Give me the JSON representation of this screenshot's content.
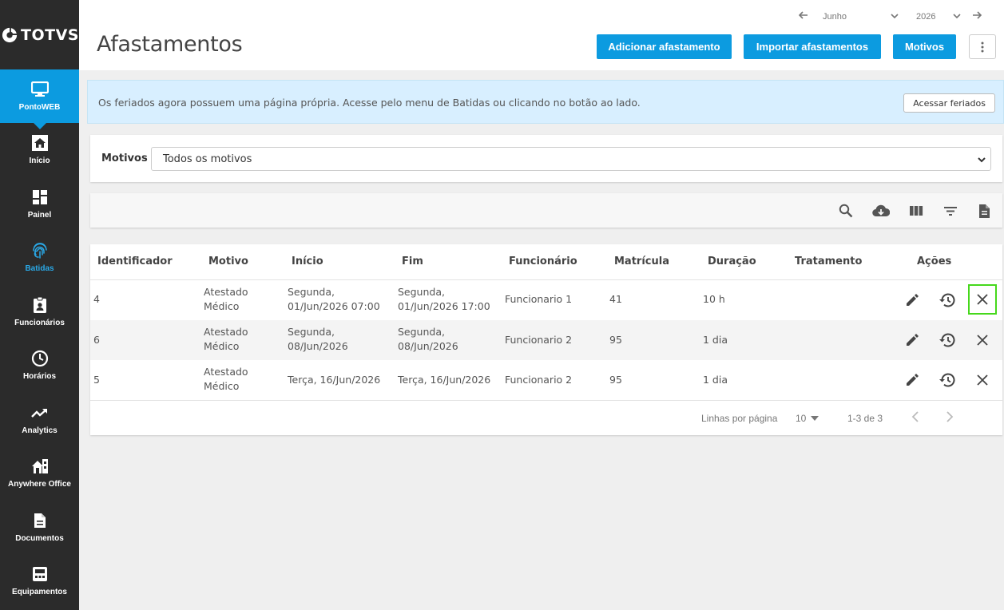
{
  "app": {
    "logo_text": "TOTVS"
  },
  "sidebar": {
    "items": [
      {
        "label": "PontoWEB",
        "icon": "monitor-icon"
      },
      {
        "label": "Início",
        "icon": "home-icon"
      },
      {
        "label": "Painel",
        "icon": "dashboard-icon"
      },
      {
        "label": "Batidas",
        "icon": "fingerprint-icon"
      },
      {
        "label": "Funcionários",
        "icon": "badge-icon"
      },
      {
        "label": "Horários",
        "icon": "clock-icon"
      },
      {
        "label": "Analytics",
        "icon": "trend-icon"
      },
      {
        "label": "Anywhere Office",
        "icon": "house-office-icon"
      },
      {
        "label": "Documentos",
        "icon": "document-icon"
      },
      {
        "label": "Equipamentos",
        "icon": "device-icon"
      }
    ]
  },
  "header": {
    "title": "Afastamentos",
    "month": "Junho",
    "year": "2026",
    "buttons": {
      "add": "Adicionar afastamento",
      "import": "Importar afastamentos",
      "reasons": "Motivos"
    }
  },
  "banner": {
    "text": "Os feriados agora possuem uma página própria. Acesse pelo menu de Batidas ou clicando no botão ao lado.",
    "button": "Acessar feriados"
  },
  "filter": {
    "label": "Motivos",
    "value": "Todos os motivos"
  },
  "table": {
    "columns": [
      "Identificador",
      "Motivo",
      "Início",
      "Fim",
      "Funcionário",
      "Matrícula",
      "Duração",
      "Tratamento",
      "Ações"
    ],
    "rows": [
      {
        "id": "4",
        "motivo_l1": "Atestado",
        "motivo_l2": "Médico",
        "inicio_l1": "Segunda,",
        "inicio_l2": "01/Jun/2026 07:00",
        "fim_l1": "Segunda,",
        "fim_l2": "01/Jun/2026 17:00",
        "funcionario": "Funcionario 1",
        "matricula": "41",
        "duracao": "10 h",
        "tratamento": ""
      },
      {
        "id": "6",
        "motivo_l1": "Atestado",
        "motivo_l2": "Médico",
        "inicio_l1": "Segunda,",
        "inicio_l2": "08/Jun/2026",
        "fim_l1": "Segunda,",
        "fim_l2": "08/Jun/2026",
        "funcionario": "Funcionario 2",
        "matricula": "95",
        "duracao": "1 dia",
        "tratamento": ""
      },
      {
        "id": "5",
        "motivo_l1": "Atestado",
        "motivo_l2": "Médico",
        "inicio_l1": "Terça, 16/Jun/2026",
        "inicio_l2": "",
        "fim_l1": "Terça, 16/Jun/2026",
        "fim_l2": "",
        "funcionario": "Funcionario 2",
        "matricula": "95",
        "duracao": "1 dia",
        "tratamento": ""
      }
    ]
  },
  "pagination": {
    "rows_label": "Linhas por página",
    "rows_value": "10",
    "range": "1-3 de 3"
  },
  "colors": {
    "accent": "#0c9be0",
    "sidebar": "#2b2b2b",
    "highlight": "#46d81c"
  }
}
